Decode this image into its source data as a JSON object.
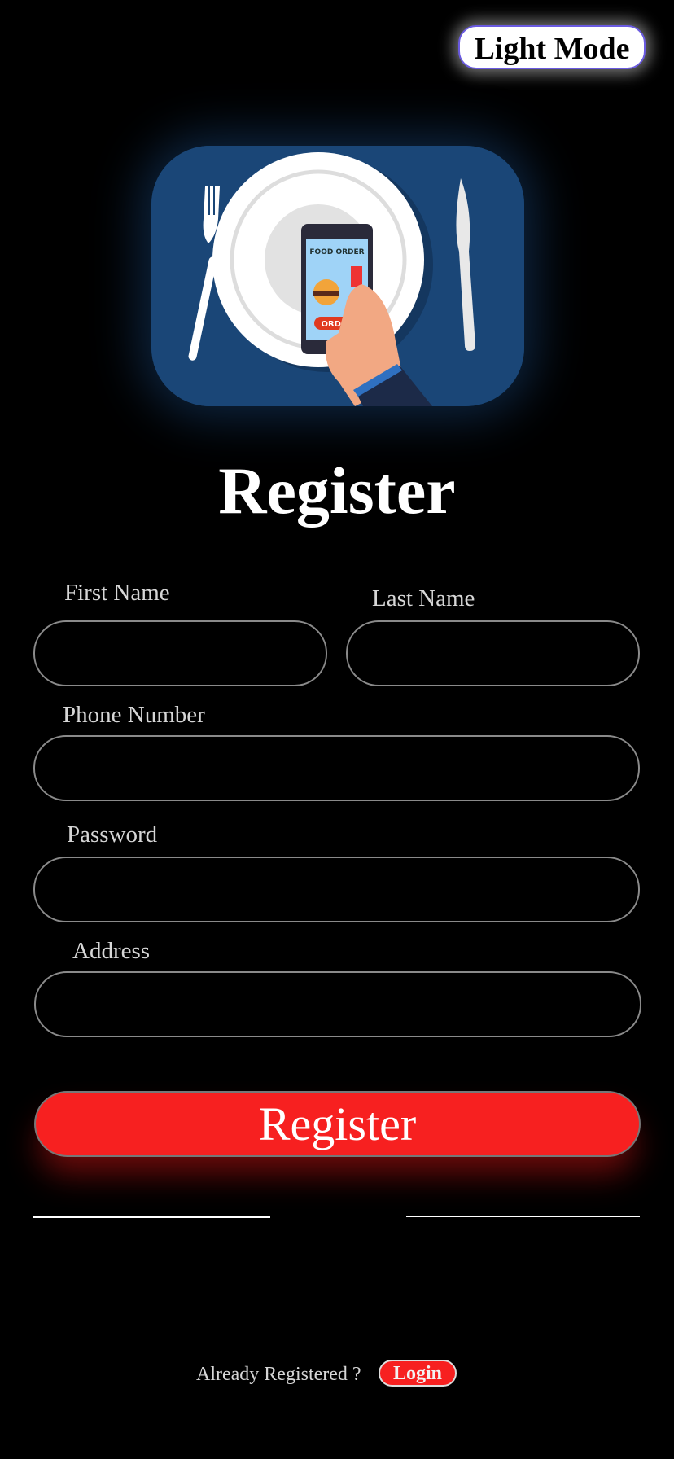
{
  "header": {
    "mode_toggle_label": "Light Mode"
  },
  "hero": {
    "phone_title": "FOOD ORDER",
    "phone_button": "ORDER"
  },
  "form": {
    "title": "Register",
    "fields": {
      "first_name": {
        "label": "First Name",
        "value": ""
      },
      "last_name": {
        "label": "Last Name",
        "value": ""
      },
      "phone": {
        "label": "Phone Number",
        "value": ""
      },
      "password": {
        "label": "Password",
        "value": ""
      },
      "address": {
        "label": "Address",
        "value": ""
      }
    },
    "submit_label": "Register"
  },
  "footer": {
    "prompt": "Already Registered ?",
    "login_label": "Login"
  },
  "colors": {
    "accent": "#f72020",
    "hero_bg": "#1a4677",
    "background": "#000000"
  }
}
